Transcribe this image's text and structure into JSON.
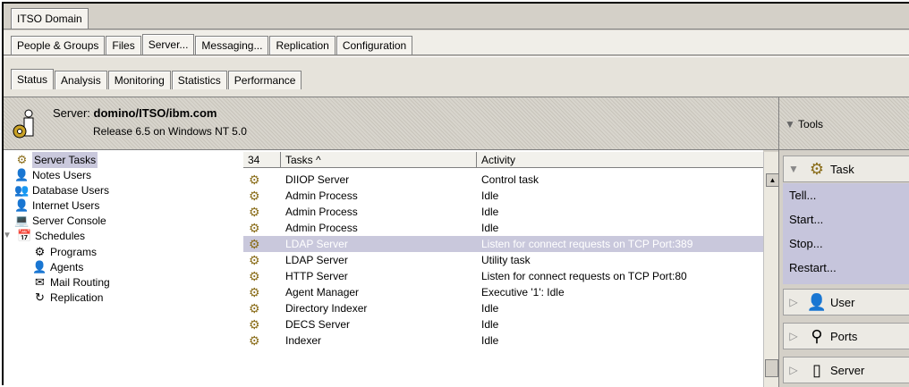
{
  "window": {
    "domain_tab": "ITSO Domain"
  },
  "main_tabs": [
    "People & Groups",
    "Files",
    "Server...",
    "Messaging...",
    "Replication",
    "Configuration"
  ],
  "sub_tabs": [
    "Status",
    "Analysis",
    "Monitoring",
    "Statistics",
    "Performance"
  ],
  "header": {
    "server_prefix": "Server:",
    "server_name": "domino/ITSO/ibm.com",
    "release": "Release 6.5 on Windows NT 5.0",
    "tools_label": "Tools"
  },
  "nav": {
    "items": [
      {
        "label": "Server Tasks",
        "icon": "gear-icon"
      },
      {
        "label": "Notes Users",
        "icon": "user-icon"
      },
      {
        "label": "Database Users",
        "icon": "users-icon"
      },
      {
        "label": "Internet Users",
        "icon": "internet-user-icon"
      },
      {
        "label": "Server Console",
        "icon": "console-icon"
      },
      {
        "label": "Schedules",
        "icon": "schedule-icon"
      },
      {
        "label": "Programs",
        "icon": "program-icon"
      },
      {
        "label": "Agents",
        "icon": "agent-icon"
      },
      {
        "label": "Mail Routing",
        "icon": "mail-icon"
      },
      {
        "label": "Replication",
        "icon": "replication-icon"
      }
    ]
  },
  "list": {
    "count": "34",
    "col_tasks": "Tasks ^",
    "col_activity": "Activity",
    "rows": [
      {
        "task": "DIIOP Server",
        "activity": "Control task"
      },
      {
        "task": "Admin Process",
        "activity": "Idle"
      },
      {
        "task": "Admin Process",
        "activity": "Idle"
      },
      {
        "task": "Admin Process",
        "activity": "Idle"
      },
      {
        "task": "LDAP Server",
        "activity": "Listen for connect requests on TCP Port:389"
      },
      {
        "task": "LDAP Server",
        "activity": "Utility task"
      },
      {
        "task": "HTTP Server",
        "activity": "Listen for connect requests on TCP Port:80"
      },
      {
        "task": "Agent Manager",
        "activity": "Executive '1': Idle"
      },
      {
        "task": "Directory Indexer",
        "activity": "Idle"
      },
      {
        "task": "DECS Server",
        "activity": "Idle"
      },
      {
        "task": "Indexer",
        "activity": "Idle"
      }
    ]
  },
  "right_panel": {
    "task_label": "Task",
    "menu": [
      "Tell...",
      "Start...",
      "Stop...",
      "Restart..."
    ],
    "user_label": "User",
    "ports_label": "Ports",
    "server_label": "Server"
  }
}
